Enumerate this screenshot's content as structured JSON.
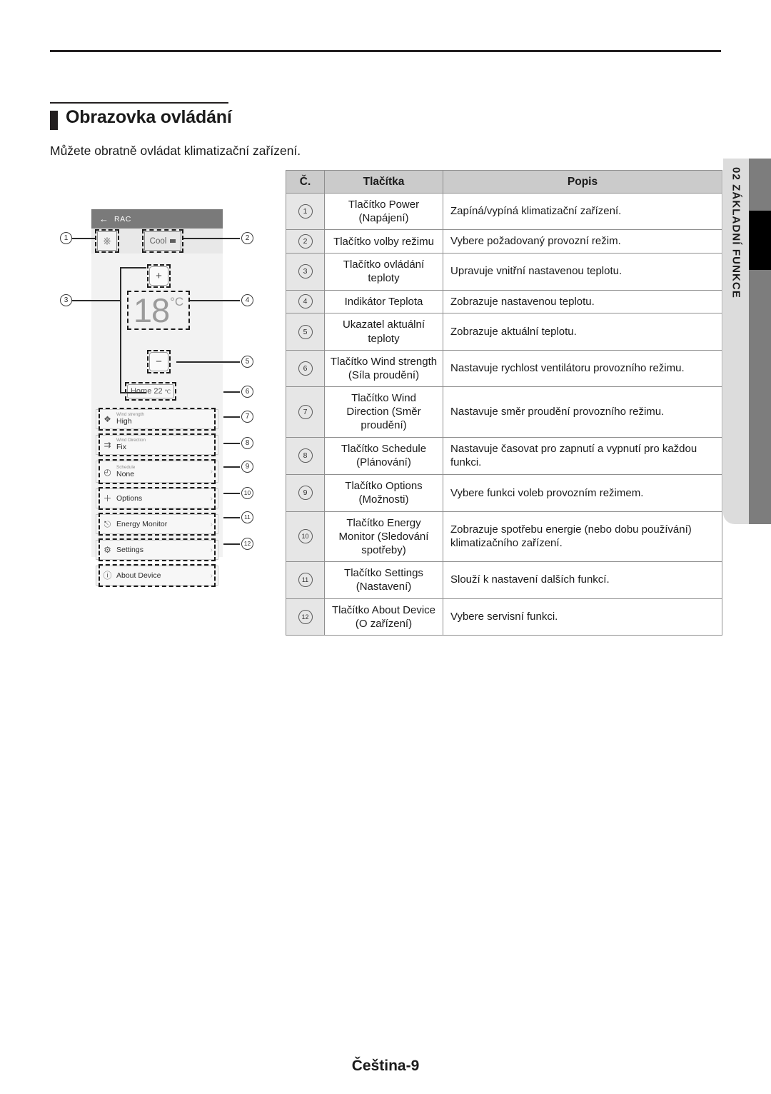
{
  "page": {
    "heading": "Obrazovka ovládání",
    "subtitle": "Můžete obratně ovládat klimatizační zařízení.",
    "footer": "Čeština-9"
  },
  "sidebar": {
    "chapter_number": "02",
    "chapter_title": "ZÁKLADNÍ FUNKCE",
    "combined": "02  ZÁKLADNÍ FUNKCE"
  },
  "app_mock": {
    "titlebar": {
      "back_icon": "arrow-left-icon",
      "title": "RAC"
    },
    "power_button": {
      "icon": "power-icon"
    },
    "mode_button": {
      "label": "Cool",
      "icon": "chevron-down-icon"
    },
    "plus_button": "+",
    "minus_button": "−",
    "temperature": {
      "value": "18",
      "unit": "°C"
    },
    "current_temp_pill": {
      "label": "Home",
      "value": "22",
      "unit": "℃"
    },
    "rows": [
      {
        "icon": "fan-icon",
        "label": "Wind strength",
        "value": "High",
        "chevron": ""
      },
      {
        "icon": "wind-direction-icon",
        "label": "Wind Direction",
        "value": "Fix",
        "chevron": ""
      },
      {
        "icon": "clock-icon",
        "label": "Schedule",
        "value": "None",
        "chevron": "›"
      },
      {
        "icon": "plus-icon",
        "label": "",
        "value": "Options",
        "chevron": "›"
      },
      {
        "icon": "energy-plug-icon",
        "label": "",
        "value": "Energy Monitor",
        "chevron": "›"
      },
      {
        "icon": "gear-icon",
        "label": "",
        "value": "Settings",
        "chevron": "›"
      },
      {
        "icon": "info-icon",
        "label": "",
        "value": "About Device",
        "chevron": "›"
      }
    ],
    "callouts": [
      "1",
      "2",
      "3",
      "4",
      "5",
      "6",
      "7",
      "8",
      "9",
      "10",
      "11",
      "12"
    ]
  },
  "table": {
    "headers": [
      "Č.",
      "Tlačítka",
      "Popis"
    ],
    "rows": [
      {
        "no": "1",
        "button": "Tlačítko Power (Napájení)",
        "desc": "Zapíná/vypíná klimatizační zařízení."
      },
      {
        "no": "2",
        "button": "Tlačítko volby režimu",
        "desc": "Vybere požadovaný provozní režim."
      },
      {
        "no": "3",
        "button": "Tlačítko ovládání teploty",
        "desc": "Upravuje vnitřní nastavenou teplotu."
      },
      {
        "no": "4",
        "button": "Indikátor Teplota",
        "desc": "Zobrazuje nastavenou teplotu."
      },
      {
        "no": "5",
        "button": "Ukazatel aktuální teploty",
        "desc": "Zobrazuje aktuální teplotu."
      },
      {
        "no": "6",
        "button": "Tlačítko Wind strength (Síla proudění)",
        "desc": "Nastavuje rychlost ventilátoru provozního režimu."
      },
      {
        "no": "7",
        "button": "Tlačítko Wind Direction (Směr proudění)",
        "desc": "Nastavuje směr proudění provozního režimu."
      },
      {
        "no": "8",
        "button": "Tlačítko Schedule (Plánování)",
        "desc": "Nastavuje časovat pro zapnutí a vypnutí pro každou funkci."
      },
      {
        "no": "9",
        "button": "Tlačítko Options (Možnosti)",
        "desc": "Vybere funkci voleb provozním režimem."
      },
      {
        "no": "10",
        "button": "Tlačítko Energy Monitor (Sledování spotřeby)",
        "desc": "Zobrazuje spotřebu energie (nebo dobu používání) klimatizačního zařízení."
      },
      {
        "no": "11",
        "button": "Tlačítko Settings (Nastavení)",
        "desc": "Slouží k nastavení dalších funkcí."
      },
      {
        "no": "12",
        "button": "Tlačítko About Device (O zařízení)",
        "desc": "Vybere servisní funkci."
      }
    ]
  },
  "colors": {
    "header_bg": "#cbcbcb",
    "no_col_bg": "#e6e6e6",
    "sidebar_panel": "#dcdcdc",
    "sidebar_strip": "#7d7d7d",
    "sidebar_marker": "#000000",
    "mock_titlebar": "#7a7a7a"
  }
}
